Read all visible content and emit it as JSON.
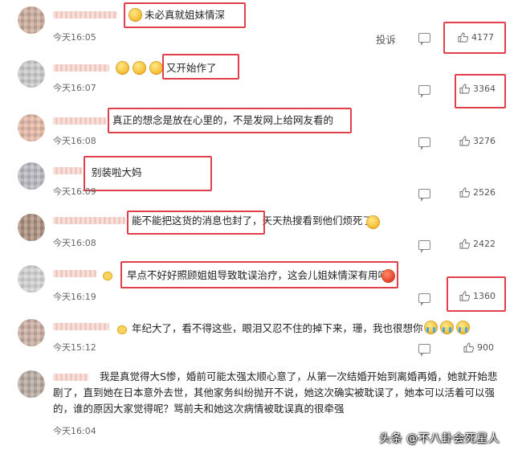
{
  "comments": [
    {
      "text": "未必真就姐妹情深",
      "time": "今天16:05",
      "likes": "4177",
      "report": "投诉"
    },
    {
      "text": "又开始作了",
      "time": "今天16:07",
      "likes": "3364"
    },
    {
      "text": "真正的想念是放在心里的，不是发网上给网友看的",
      "time": "今天16:08",
      "likes": "3276"
    },
    {
      "text": "别装啦大妈",
      "time": "今天16:09",
      "likes": "2526"
    },
    {
      "text": "能不能把这货的消息也封了，天天热搜看到他们烦死了",
      "time": "今天16:08",
      "likes": "2422"
    },
    {
      "text": "早点不好好照顾姐姐导致耽误治疗，这会儿姐妹情深有用吗",
      "time": "今天16:19",
      "likes": "1360"
    },
    {
      "text": "年纪大了，看不得这些，眼泪又忍不住的掉下来，珊，我也很想你",
      "time": "今天15:12",
      "likes": "900"
    },
    {
      "text": "我是真觉得大S惨，婚前可能太强太顺心意了，从第一次结婚开始到离婚再婚，她就开始悲剧了，直到她在日本意外去世，其他家务纠纷抛开不说，她这次确实被耽误了，她本可以活着可以强的，谁的原因大家觉得呢？骂前夫和她这次病情被耽误真的很牵强",
      "time": "今天16:04"
    }
  ],
  "watermark": "头条 @不八卦会死星人",
  "colors": {
    "highlight": "#e0404c",
    "time": "#666666",
    "text": "#222222"
  },
  "icons": [
    "thumb-up-icon",
    "reply-icon",
    "avatar"
  ]
}
